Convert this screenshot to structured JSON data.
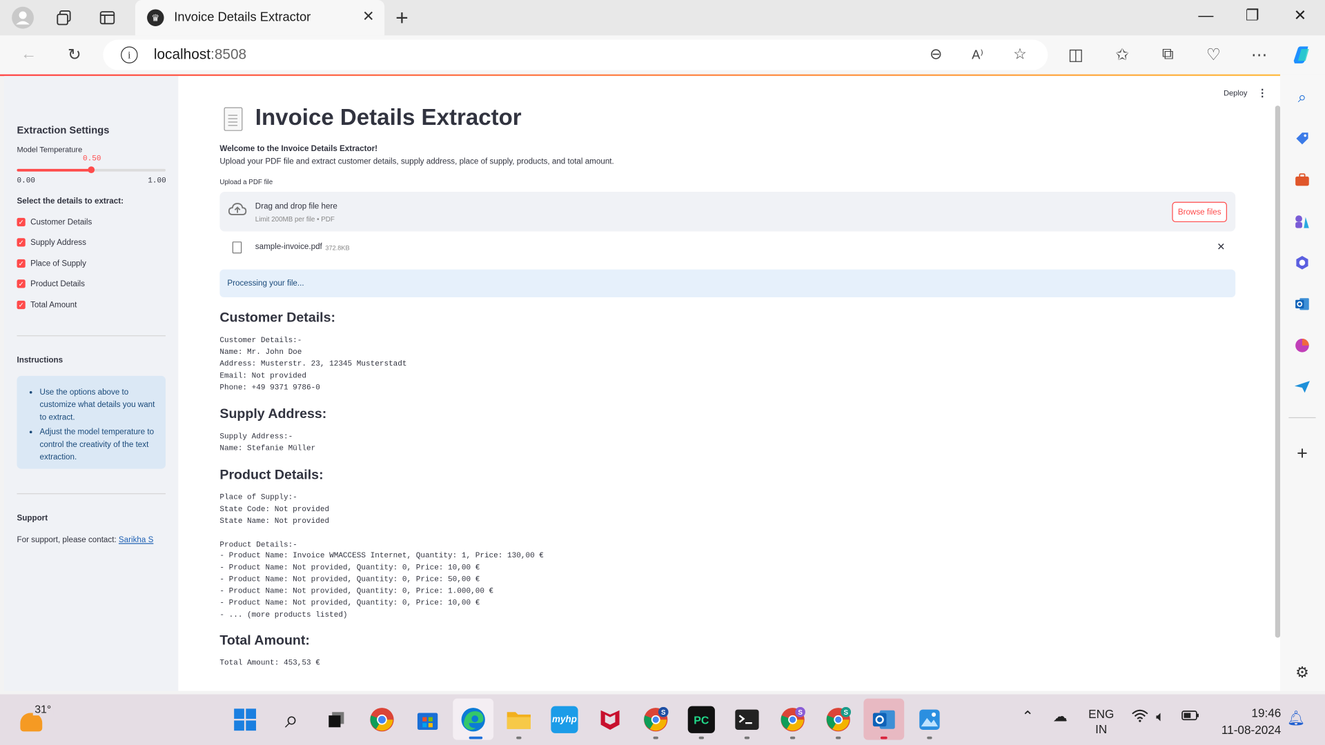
{
  "browser": {
    "tab_title": "Invoice Details Extractor",
    "tab_close": "✕",
    "new_tab": "+",
    "url_host": "localhost",
    "url_port": ":8508",
    "window_controls": {
      "minimize": "—",
      "restore": "❐",
      "close": "✕"
    },
    "icons": [
      "profile-icon",
      "workspaces-icon",
      "tab-actions-icon",
      "back-icon",
      "refresh-icon",
      "info-icon",
      "zoom-out-icon",
      "read-aloud-icon",
      "favorite-star-icon",
      "split-screen-icon",
      "favorites-icon",
      "collections-icon",
      "browser-essentials-icon",
      "more-icon",
      "copilot-icon"
    ]
  },
  "app": {
    "deploy_label": "Deploy",
    "kebab": "⋮",
    "title": "Invoice Details Extractor",
    "welcome": "Welcome to the Invoice Details Extractor!",
    "description": "Upload your PDF file and extract customer details, supply address, place of supply, products, and total amount.",
    "upload_label": "Upload a PDF file",
    "dropzone": {
      "main": "Drag and drop file here",
      "sub": "Limit 200MB per file • PDF",
      "browse": "Browse files"
    },
    "file": {
      "name": "sample-invoice.pdf",
      "size": "372.8KB",
      "remove": "✕"
    },
    "status": "Processing your file..."
  },
  "sidebar": {
    "settings_title": "Extraction Settings",
    "temperature_label": "Model Temperature",
    "temperature_value": "0.50",
    "temperature_fraction": 0.5,
    "temperature_min": "0.00",
    "temperature_max": "1.00",
    "select_label": "Select the details to extract:",
    "options": [
      {
        "label": "Customer Details",
        "checked": true
      },
      {
        "label": "Supply Address",
        "checked": true
      },
      {
        "label": "Place of Supply",
        "checked": true
      },
      {
        "label": "Product Details",
        "checked": true
      },
      {
        "label": "Total Amount",
        "checked": true
      }
    ],
    "instructions_title": "Instructions",
    "instructions": [
      "Use the options above to customize what details you want to extract.",
      "Adjust the model temperature to control the creativity of the text extraction."
    ],
    "support_title": "Support",
    "support_text": "For support, please contact: ",
    "support_link": "Sarikha S"
  },
  "results": {
    "customer": {
      "heading": "Customer Details:",
      "lines": [
        "Customer Details:-",
        "Name: Mr. John Doe",
        "Address: Musterstr. 23, 12345 Musterstadt",
        "Email: Not provided",
        "Phone: +49 9371 9786-0"
      ]
    },
    "supply": {
      "heading": "Supply Address:",
      "lines": [
        "Supply Address:-",
        "Name: Stefanie Müller"
      ]
    },
    "product": {
      "heading": "Product Details:",
      "lines": [
        "Place of Supply:-",
        "State Code: Not provided",
        "State Name: Not provided",
        "",
        "Product Details:-",
        "- Product Name: Invoice WMACCESS Internet, Quantity: 1, Price: 130,00 €",
        "- Product Name: Not provided, Quantity: 0, Price: 10,00 €",
        "- Product Name: Not provided, Quantity: 0, Price: 50,00 €",
        "- Product Name: Not provided, Quantity: 0, Price: 1.000,00 €",
        "- Product Name: Not provided, Quantity: 0, Price: 10,00 €",
        "- ... (more products listed)"
      ]
    },
    "total": {
      "heading": "Total Amount:",
      "lines": [
        "Total Amount: 453,53 €"
      ]
    }
  },
  "taskbar": {
    "weather_temp": "31°",
    "lang_1": "ENG",
    "lang_2": "IN",
    "time": "19:46",
    "date": "11-08-2024"
  },
  "colors": {
    "accent": "#ff4b4b",
    "sidebar_bg": "#f0f2f6",
    "info_bg": "#dbe8f5",
    "text": "#31333f"
  }
}
